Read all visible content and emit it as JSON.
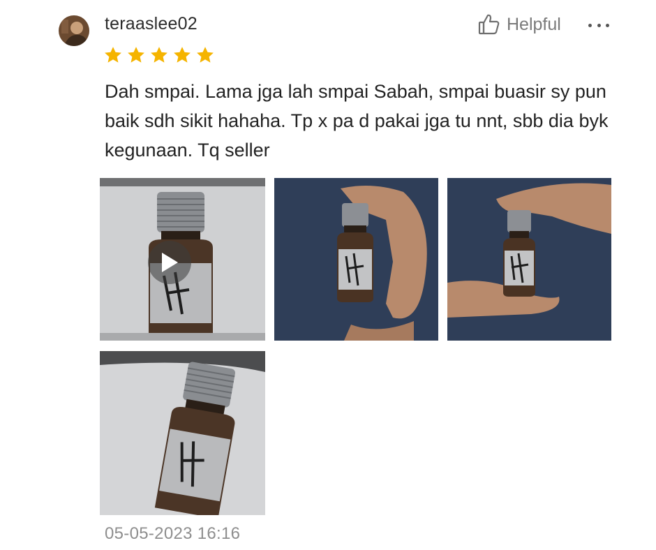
{
  "review": {
    "username": "teraaslee02",
    "helpful_label": "Helpful",
    "rating": 5,
    "star_color": "#f5b400",
    "text": "Dah smpai. Lama jga lah smpai Sabah, smpai buasir sy pun baik sdh sikit hahaha. Tp x pa d pakai jga tu nnt, sbb dia byk kegunaan. Tq seller",
    "timestamp": "05-05-2023 16:16"
  },
  "media": [
    {
      "type": "video",
      "icon": "play-icon"
    },
    {
      "type": "photo"
    },
    {
      "type": "photo"
    },
    {
      "type": "photo"
    }
  ]
}
